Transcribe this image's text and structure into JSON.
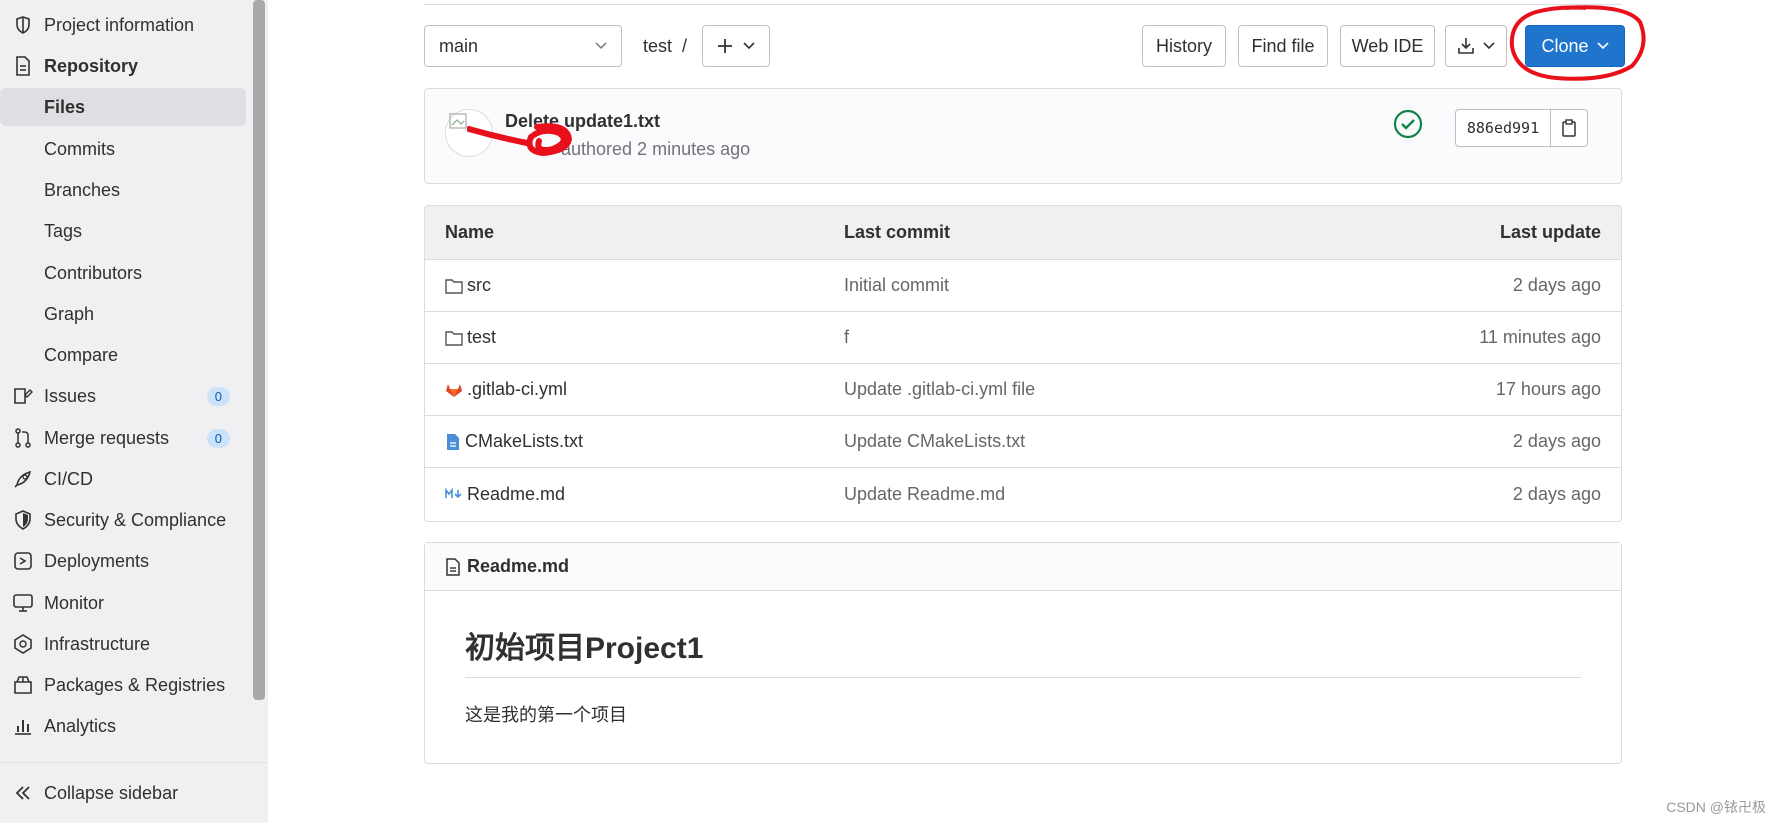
{
  "sidebar": {
    "items": [
      {
        "label": "Project information",
        "icon": "info-icon"
      },
      {
        "label": "Repository",
        "icon": "document-icon"
      },
      {
        "label": "Files"
      },
      {
        "label": "Commits"
      },
      {
        "label": "Branches"
      },
      {
        "label": "Tags"
      },
      {
        "label": "Contributors"
      },
      {
        "label": "Graph"
      },
      {
        "label": "Compare"
      },
      {
        "label": "Issues",
        "icon": "issues-icon",
        "badge": "0"
      },
      {
        "label": "Merge requests",
        "icon": "merge-icon",
        "badge": "0"
      },
      {
        "label": "CI/CD",
        "icon": "rocket-icon"
      },
      {
        "label": "Security & Compliance",
        "icon": "shield-icon"
      },
      {
        "label": "Deployments",
        "icon": "deployments-icon"
      },
      {
        "label": "Monitor",
        "icon": "monitor-icon"
      },
      {
        "label": "Infrastructure",
        "icon": "infrastructure-icon"
      },
      {
        "label": "Packages & Registries",
        "icon": "package-icon"
      },
      {
        "label": "Analytics",
        "icon": "analytics-icon"
      }
    ],
    "collapse_label": "Collapse sidebar"
  },
  "toolbar": {
    "branch": "main",
    "path": "test",
    "path_sep": "/",
    "history": "History",
    "find_file": "Find file",
    "web_ide": "Web IDE",
    "clone": "Clone"
  },
  "commit": {
    "title": "Delete update1.txt",
    "meta": "authored 2 minutes ago",
    "sha": "886ed991"
  },
  "table": {
    "headers": {
      "name": "Name",
      "last_commit": "Last commit",
      "last_update": "Last update"
    },
    "rows": [
      {
        "name": "src",
        "icon": "folder-icon",
        "commit": "Initial commit",
        "updated": "2 days ago"
      },
      {
        "name": "test",
        "icon": "folder-icon",
        "commit": "f",
        "updated": "11 minutes ago"
      },
      {
        "name": ".gitlab-ci.yml",
        "icon": "gitlab-icon",
        "commit": "Update .gitlab-ci.yml file",
        "updated": "17 hours ago"
      },
      {
        "name": "CMakeLists.txt",
        "icon": "file-icon",
        "commit": "Update CMakeLists.txt",
        "updated": "2 days ago"
      },
      {
        "name": "Readme.md",
        "icon": "markdown-icon",
        "commit": "Update Readme.md",
        "updated": "2 days ago"
      }
    ]
  },
  "readme": {
    "filename": "Readme.md",
    "heading": "初始项目Project1",
    "body": "这是我的第一个项目"
  },
  "watermark": "CSDN @铱卍极",
  "colors": {
    "primary": "#1f75cb",
    "success": "#108548",
    "annotation": "#e8101a"
  }
}
